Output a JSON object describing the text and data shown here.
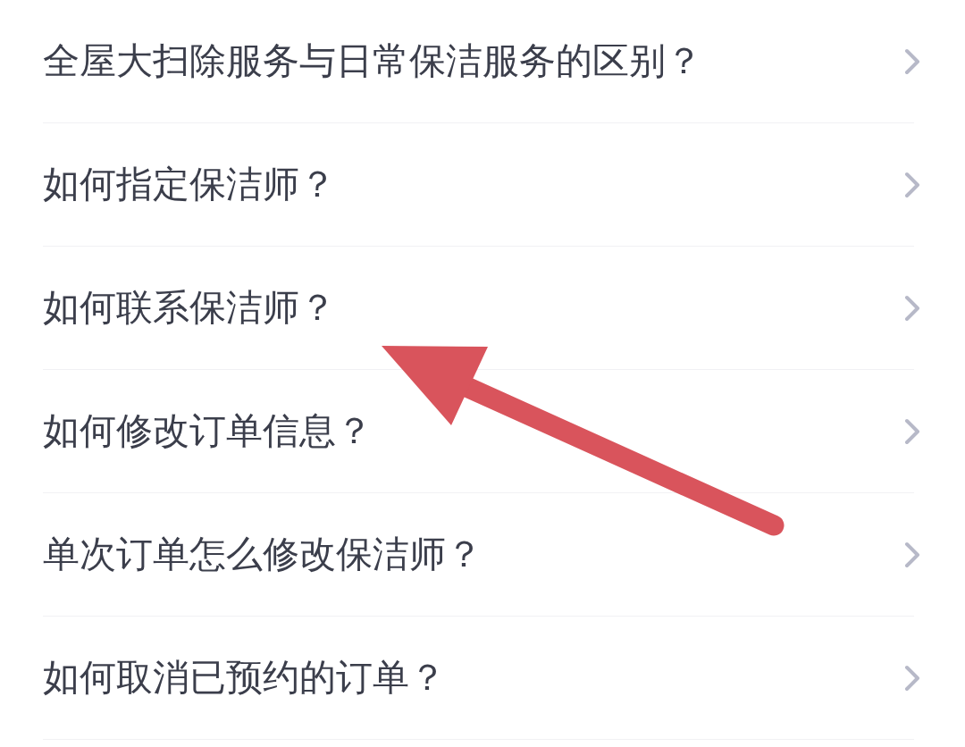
{
  "faq_items": [
    {
      "question": "全屋大扫除服务与日常保洁服务的区别？"
    },
    {
      "question": "如何指定保洁师？"
    },
    {
      "question": "如何联系保洁师？"
    },
    {
      "question": "如何修改订单信息？"
    },
    {
      "question": "单次订单怎么修改保洁师？"
    },
    {
      "question": "如何取消已预约的订单？"
    }
  ]
}
